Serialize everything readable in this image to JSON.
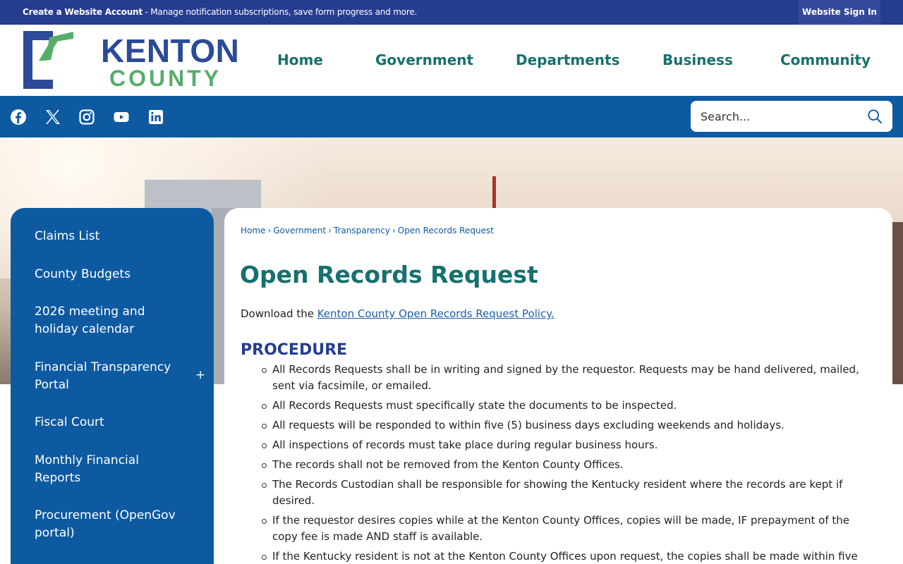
{
  "topbar": {
    "message_bold": "Create a Website Account",
    "message_rest": " - Manage notification subscriptions, save form progress and more.",
    "signin_label": "Website Sign In"
  },
  "logo": {
    "line1": "KENTON",
    "line2": "COUNTY"
  },
  "nav": [
    "Home",
    "Government",
    "Departments",
    "Business",
    "Community"
  ],
  "social": [
    "facebook-icon",
    "x-icon",
    "instagram-icon",
    "youtube-icon",
    "linkedin-icon"
  ],
  "search": {
    "placeholder": "Search..."
  },
  "sidebar": {
    "items": [
      {
        "label": "Claims List"
      },
      {
        "label": "County Budgets"
      },
      {
        "label": "2026 meeting and holiday calendar"
      },
      {
        "label": "Financial Transparency Portal",
        "expand": "+"
      },
      {
        "label": "Fiscal Court"
      },
      {
        "label": "Monthly Financial Reports"
      },
      {
        "label": "Procurement (OpenGov portal)"
      }
    ]
  },
  "breadcrumb": [
    "Home",
    "Government",
    "Transparency",
    "Open Records Request"
  ],
  "breadcrumb_sep": "›",
  "page": {
    "title": "Open Records Request",
    "intro_text": "Download the ",
    "intro_link": "Kenton County Open Records Request Policy.",
    "section_heading": "PROCEDURE",
    "procedure": [
      "All Records Requests shall be in writing and signed by the requestor. Requests may be hand delivered, mailed, sent via facsimile, or emailed.",
      "All Records Requests must specifically state the documents to be inspected.",
      " All requests will be responded to within five (5) business days excluding weekends and holidays.",
      "All inspections of records must take place during regular business hours.",
      "The records shall not be removed from the Kenton County Offices.",
      "The Records Custodian shall be responsible for showing the Kentucky resident where the records are kept if desired.",
      "If the requestor desires copies while at the Kenton County Offices, copies will be made, IF prepayment of the copy fee is made AND staff is available.",
      "If the Kentucky resident is not at the Kenton County Offices upon request, the copies shall be made within five"
    ]
  }
}
